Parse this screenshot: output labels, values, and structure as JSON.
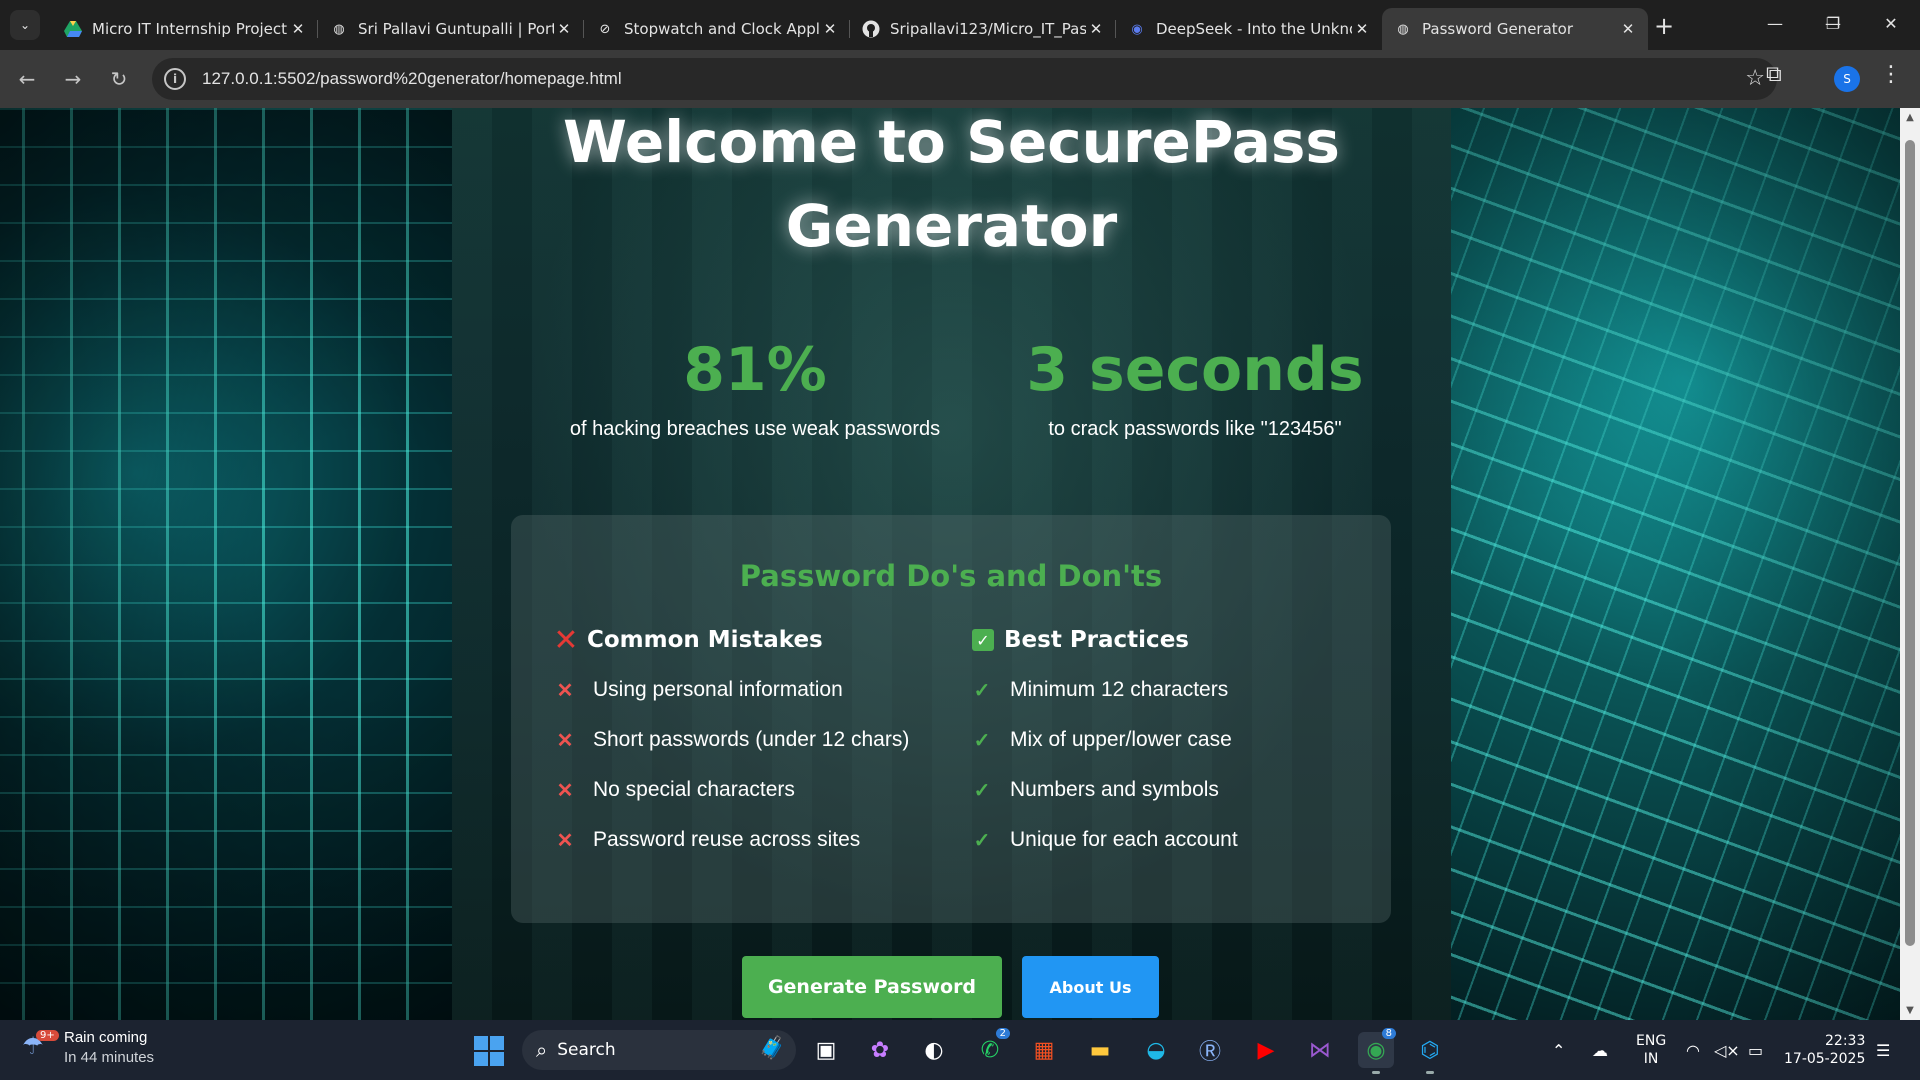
{
  "browser": {
    "tabs": [
      {
        "title": "Micro IT Internship Project",
        "icon": "google-drive-icon",
        "active": false
      },
      {
        "title": "Sri Pallavi Guntupalli | Portf",
        "icon": "globe-icon",
        "active": false
      },
      {
        "title": "Stopwatch and Clock Appli",
        "icon": "stopwatch-icon",
        "active": false
      },
      {
        "title": "Sripallavi123/Micro_IT_Pas",
        "icon": "github-icon",
        "active": false
      },
      {
        "title": "DeepSeek - Into the Unkno",
        "icon": "deepseek-icon",
        "active": false
      },
      {
        "title": "Password Generator",
        "icon": "globe-icon",
        "active": true
      }
    ],
    "url": "127.0.0.1:5502/password%20generator/homepage.html",
    "profile_initial": "S"
  },
  "page": {
    "title": "Welcome to SecurePass Generator",
    "stats": [
      {
        "value": "81%",
        "label": "of hacking breaches use weak passwords"
      },
      {
        "value": "3 seconds",
        "label": "to crack passwords like \"123456\""
      }
    ],
    "card": {
      "title": "Password Do's and Don'ts",
      "mistakes": {
        "heading": "Common Mistakes",
        "items": [
          "Using personal information",
          "Short passwords (under 12 chars)",
          "No special characters",
          "Password reuse across sites"
        ]
      },
      "practices": {
        "heading": "Best Practices",
        "items": [
          "Minimum 12 characters",
          "Mix of upper/lower case",
          "Numbers and symbols",
          "Unique for each account"
        ]
      }
    },
    "buttons": {
      "generate": "Generate Password",
      "about": "About Us"
    },
    "colors": {
      "accent_green": "#4caf50",
      "button_blue": "#2196f3",
      "cross_red": "#e53935"
    }
  },
  "taskbar": {
    "weather_title": "Rain coming",
    "weather_sub": "In 44 minutes",
    "weather_badge": "9+",
    "search_label": "Search",
    "whatsapp_badge": "2",
    "chrome_badge": "8",
    "lang_top": "ENG",
    "lang_bottom": "IN",
    "time": "22:33",
    "date": "17-05-2025"
  }
}
